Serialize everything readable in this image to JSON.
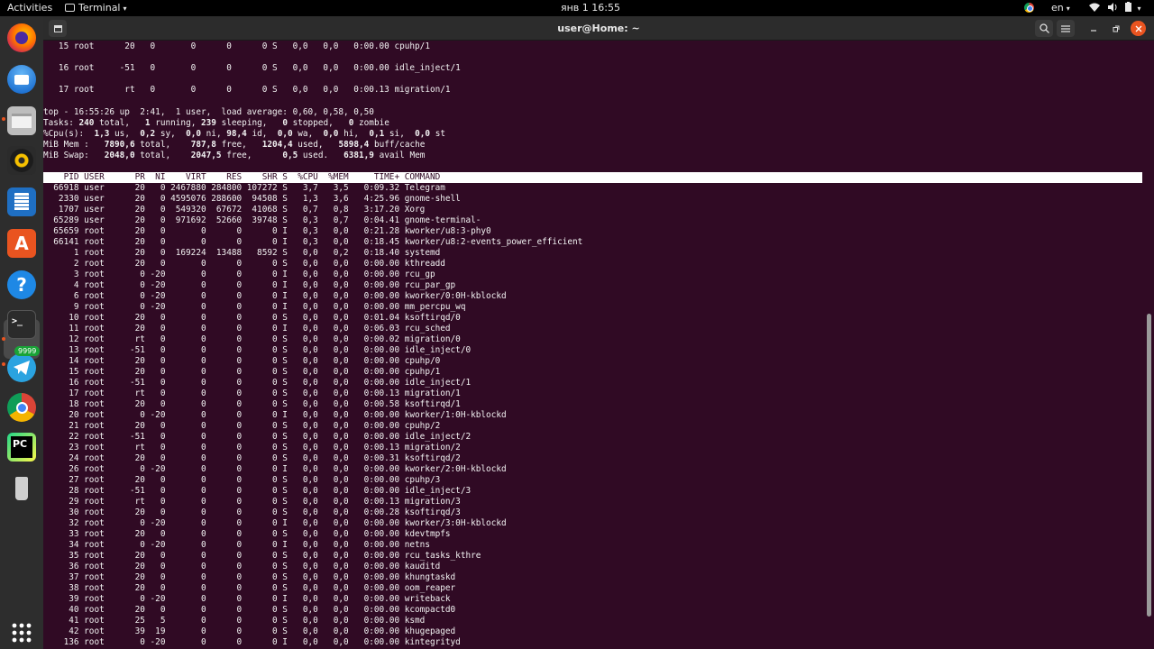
{
  "topbar": {
    "activities": "Activities",
    "app_name": "Terminal",
    "clock": "янв 1  16:55",
    "language": "en",
    "caret": "▾"
  },
  "dock": {
    "badge": "9999",
    "apps": [
      "firefox-icon",
      "thunderbird-icon",
      "files-icon",
      "rhythmbox-icon",
      "writer-icon",
      "software-icon",
      "help-icon",
      "terminal-icon",
      "telegram-icon",
      "chrome-icon",
      "pycharm-icon",
      "usb-drive-icon",
      "show-apps-icon"
    ]
  },
  "window": {
    "title": "user@Home: ~"
  },
  "terminal": {
    "pre_rows": [
      "   15 root      20   0       0      0      0 S   0,0   0,0   0:00.00 cpuhp/1",
      "   16 root     -51   0       0      0      0 S   0,0   0,0   0:00.00 idle_inject/1",
      "   17 root      rt   0       0      0      0 S   0,0   0,0   0:00.13 migration/1"
    ],
    "summary": {
      "line1": "top - 16:55:26 up  2:41,  1 user,  load average: 0,60, 0,58, 0,50",
      "tasks": [
        "Tasks: ",
        "240",
        " total,   ",
        "1",
        " running, ",
        "239",
        " sleeping,   ",
        "0",
        " stopped,   ",
        "0",
        " zombie"
      ],
      "cpu": [
        "%Cpu(s):  ",
        "1,3",
        " us,  ",
        "0,2",
        " sy,  ",
        "0,0",
        " ni, ",
        "98,4",
        " id,  ",
        "0,0",
        " wa,  ",
        "0,0",
        " hi,  ",
        "0,1",
        " si,  ",
        "0,0",
        " st"
      ],
      "mem": [
        "MiB Mem :   ",
        "7890,6",
        " total,    ",
        "787,8",
        " free,   ",
        "1204,4",
        " used,   ",
        "5898,4",
        " buff/cache"
      ],
      "swap": [
        "MiB Swap:   ",
        "2048,0",
        " total,    ",
        "2047,5",
        " free,      ",
        "0,5",
        " used.   ",
        "6381,9",
        " avail Mem"
      ]
    },
    "column_header": "    PID USER      PR  NI    VIRT    RES    SHR S  %CPU  %MEM     TIME+ COMMAND",
    "processes": [
      "  66918 user      20   0 2467880 284800 107272 S   3,7   3,5   0:09.32 Telegram",
      "   2330 user      20   0 4595076 288600  94508 S   1,3   3,6   4:25.96 gnome-shell",
      "   1707 user      20   0  549320  67672  41068 S   0,7   0,8   3:17.20 Xorg",
      "  65289 user      20   0  971692  52660  39748 S   0,3   0,7   0:04.41 gnome-terminal-",
      "  65659 root      20   0       0      0      0 I   0,3   0,0   0:21.28 kworker/u8:3-phy0",
      "  66141 root      20   0       0      0      0 I   0,3   0,0   0:18.45 kworker/u8:2-events_power_efficient",
      "      1 root      20   0  169224  13488   8592 S   0,0   0,2   0:18.40 systemd",
      "      2 root      20   0       0      0      0 S   0,0   0,0   0:00.00 kthreadd",
      "      3 root       0 -20       0      0      0 I   0,0   0,0   0:00.00 rcu_gp",
      "      4 root       0 -20       0      0      0 I   0,0   0,0   0:00.00 rcu_par_gp",
      "      6 root       0 -20       0      0      0 I   0,0   0,0   0:00.00 kworker/0:0H-kblockd",
      "      9 root       0 -20       0      0      0 I   0,0   0,0   0:00.00 mm_percpu_wq",
      "     10 root      20   0       0      0      0 S   0,0   0,0   0:01.04 ksoftirqd/0",
      "     11 root      20   0       0      0      0 I   0,0   0,0   0:06.03 rcu_sched",
      "     12 root      rt   0       0      0      0 S   0,0   0,0   0:00.02 migration/0",
      "     13 root     -51   0       0      0      0 S   0,0   0,0   0:00.00 idle_inject/0",
      "     14 root      20   0       0      0      0 S   0,0   0,0   0:00.00 cpuhp/0",
      "     15 root      20   0       0      0      0 S   0,0   0,0   0:00.00 cpuhp/1",
      "     16 root     -51   0       0      0      0 S   0,0   0,0   0:00.00 idle_inject/1",
      "     17 root      rt   0       0      0      0 S   0,0   0,0   0:00.13 migration/1",
      "     18 root      20   0       0      0      0 S   0,0   0,0   0:00.58 ksoftirqd/1",
      "     20 root       0 -20       0      0      0 I   0,0   0,0   0:00.00 kworker/1:0H-kblockd",
      "     21 root      20   0       0      0      0 S   0,0   0,0   0:00.00 cpuhp/2",
      "     22 root     -51   0       0      0      0 S   0,0   0,0   0:00.00 idle_inject/2",
      "     23 root      rt   0       0      0      0 S   0,0   0,0   0:00.13 migration/2",
      "     24 root      20   0       0      0      0 S   0,0   0,0   0:00.31 ksoftirqd/2",
      "     26 root       0 -20       0      0      0 I   0,0   0,0   0:00.00 kworker/2:0H-kblockd",
      "     27 root      20   0       0      0      0 S   0,0   0,0   0:00.00 cpuhp/3",
      "     28 root     -51   0       0      0      0 S   0,0   0,0   0:00.00 idle_inject/3",
      "     29 root      rt   0       0      0      0 S   0,0   0,0   0:00.13 migration/3",
      "     30 root      20   0       0      0      0 S   0,0   0,0   0:00.28 ksoftirqd/3",
      "     32 root       0 -20       0      0      0 I   0,0   0,0   0:00.00 kworker/3:0H-kblockd",
      "     33 root      20   0       0      0      0 S   0,0   0,0   0:00.00 kdevtmpfs",
      "     34 root       0 -20       0      0      0 I   0,0   0,0   0:00.00 netns",
      "     35 root      20   0       0      0      0 S   0,0   0,0   0:00.00 rcu_tasks_kthre",
      "     36 root      20   0       0      0      0 S   0,0   0,0   0:00.00 kauditd",
      "     37 root      20   0       0      0      0 S   0,0   0,0   0:00.00 khungtaskd",
      "     38 root      20   0       0      0      0 S   0,0   0,0   0:00.00 oom_reaper",
      "     39 root       0 -20       0      0      0 I   0,0   0,0   0:00.00 writeback",
      "     40 root      20   0       0      0      0 S   0,0   0,0   0:00.00 kcompactd0",
      "     41 root      25   5       0      0      0 S   0,0   0,0   0:00.00 ksmd",
      "     42 root      39  19       0      0      0 S   0,0   0,0   0:00.00 khugepaged",
      "    136 root       0 -20       0      0      0 I   0,0   0,0   0:00.00 kintegrityd"
    ]
  }
}
